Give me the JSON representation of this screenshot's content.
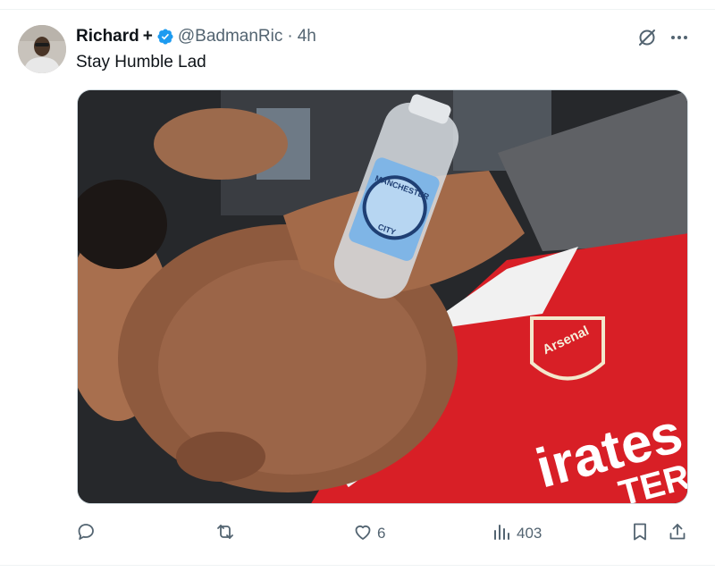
{
  "tweet": {
    "display_name": "Richard",
    "name_symbol": "+",
    "handle": "@BadmanRic",
    "separator": "·",
    "time": "4h",
    "text": "Stay Humble Lad"
  },
  "icons": {
    "verified": "verified-badge-icon",
    "grok": "grok-icon",
    "more": "more-icon",
    "reply": "reply-icon",
    "retweet": "retweet-icon",
    "like": "like-icon",
    "views": "views-icon",
    "bookmark": "bookmark-icon",
    "share": "share-icon"
  },
  "media": {
    "bottle_label_top": "MANCHESTER",
    "bottle_label_bottom": "CITY",
    "crest_text": "Arsenal",
    "shirt_sponsor": "irates",
    "shirt_sponsor_second": "TER"
  },
  "actions": {
    "likes": "6",
    "views": "403"
  },
  "colors": {
    "verified": "#1d9bf0",
    "muted": "#536471",
    "shirt_red": "#d81f26",
    "bottle_blue": "#7fb5e6"
  }
}
